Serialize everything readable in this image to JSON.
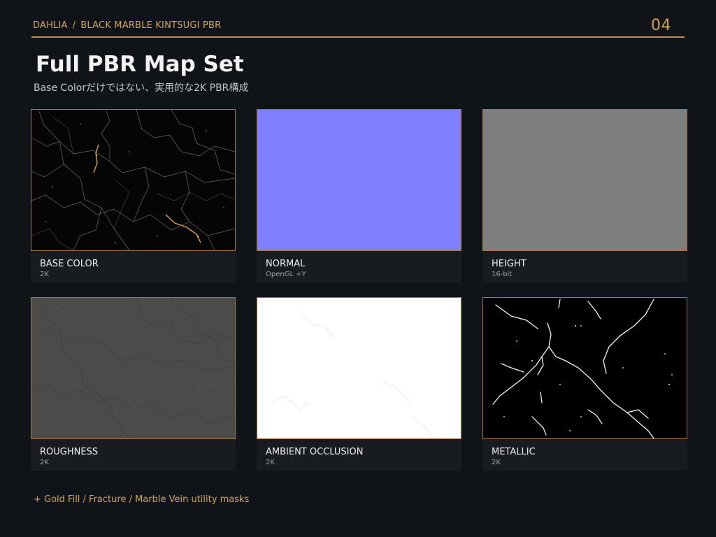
{
  "header": {
    "brand": "DAHLIA",
    "separator": "/",
    "product": "BLACK MARBLE KINTSUGI PBR",
    "page_number": "04"
  },
  "title": "Full PBR Map Set",
  "subtitle": "Base Colorだけではない、実用的な2K PBR構成",
  "maps": [
    {
      "name": "BASE COLOR",
      "detail": "2K",
      "icon": "black-marble-gold-veins-texture"
    },
    {
      "name": "NORMAL",
      "detail": "OpenGL +Y",
      "icon": "flat-normal-map-texture"
    },
    {
      "name": "HEIGHT",
      "detail": "16-bit",
      "icon": "gray-height-map-texture"
    },
    {
      "name": "ROUGHNESS",
      "detail": "2K",
      "icon": "dark-gray-roughness-texture"
    },
    {
      "name": "AMBIENT OCCLUSION",
      "detail": "2K",
      "icon": "white-ao-texture"
    },
    {
      "name": "METALLIC",
      "detail": "2K",
      "icon": "black-white-vein-mask-texture"
    }
  ],
  "footer_note": "+ Gold Fill / Fracture / Marble Vein utility masks",
  "colors": {
    "background": "#101317",
    "accent_gold": "#d4a65a",
    "normal_map": "#8080ff",
    "height_map": "#7e7e7e",
    "roughness_map": "#4c4c4c",
    "ao_map": "#ffffff",
    "metallic_map": "#000000"
  }
}
